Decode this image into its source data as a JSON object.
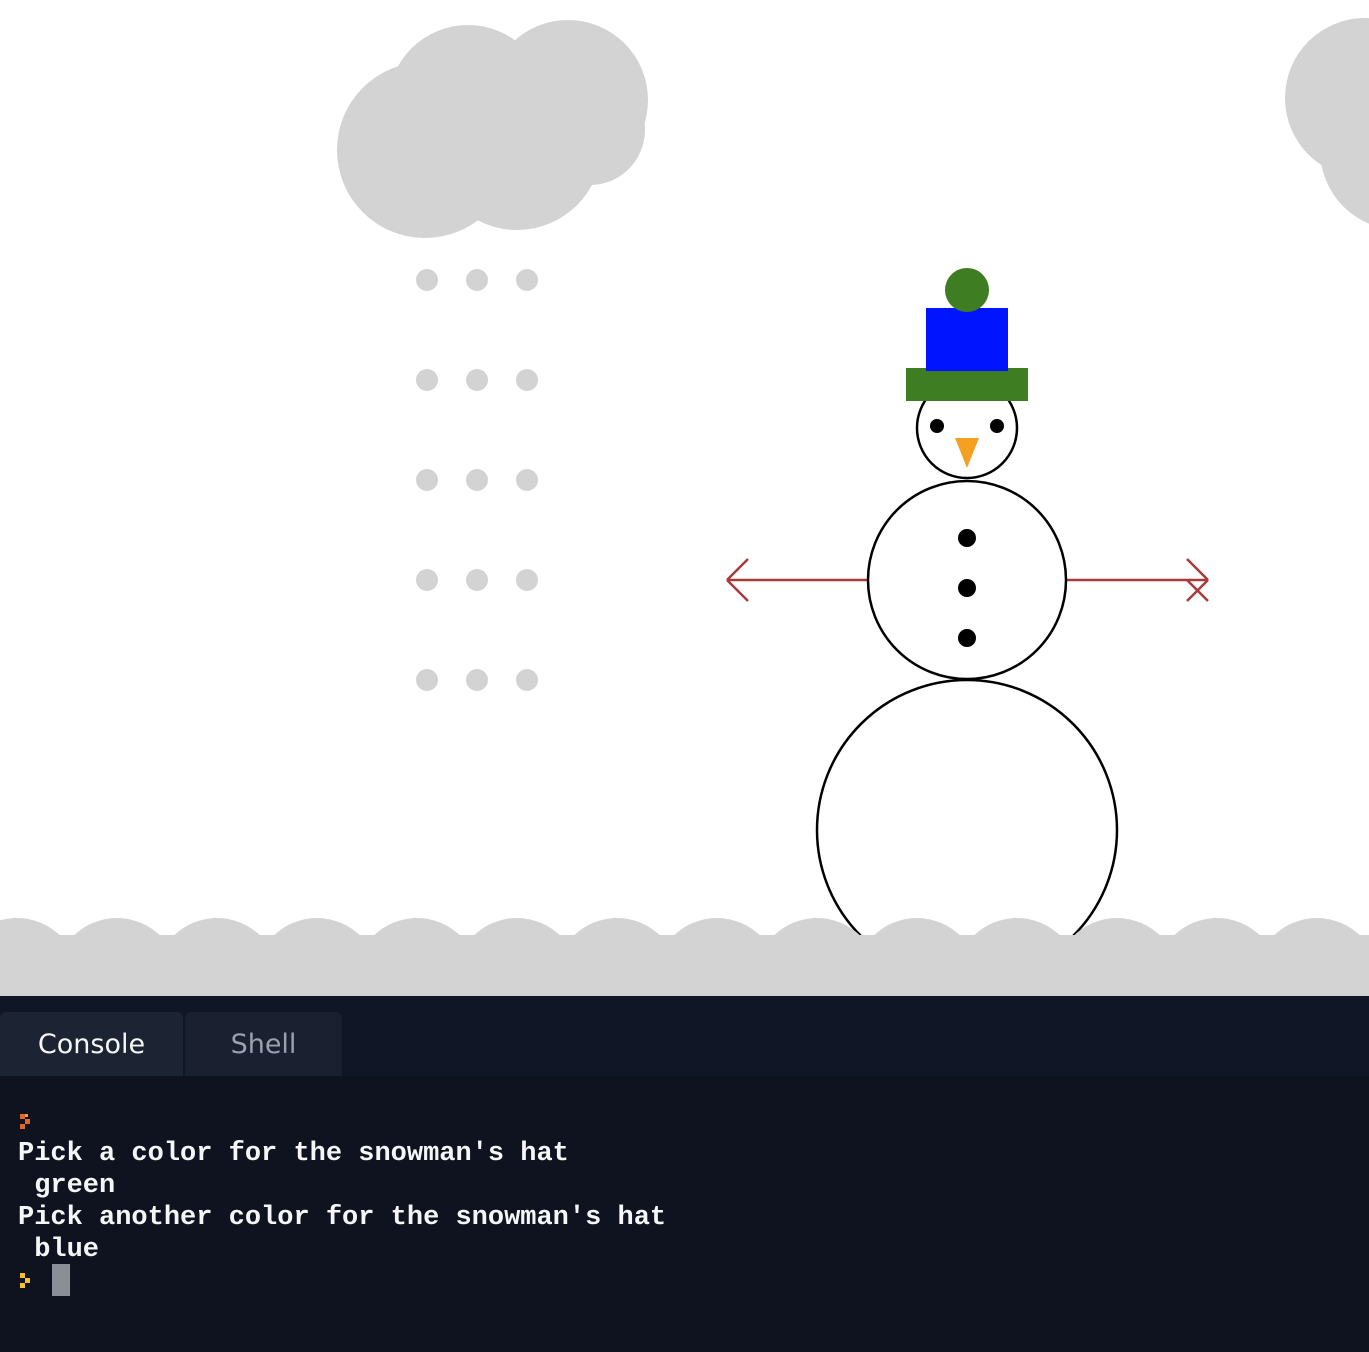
{
  "canvas": {
    "background": "#ffffff",
    "snow_color": "#d3d3d3",
    "hat_brim_color": "#3e7d22",
    "hat_top_color": "#0014ff",
    "pompom_color": "#3e7d22",
    "nose_color": "#f5a021",
    "arm_color": "#a83a3a"
  },
  "panel": {
    "tabs": [
      {
        "label": "Console",
        "active": true
      },
      {
        "label": "Shell",
        "active": false
      }
    ]
  },
  "console": {
    "lines": [
      "Pick a color for the snowman's hat",
      " green",
      "Pick another color for the snowman's hat",
      " blue"
    ],
    "prompt_color_first": "#e0692a",
    "prompt_color_active": "#f2c230"
  }
}
